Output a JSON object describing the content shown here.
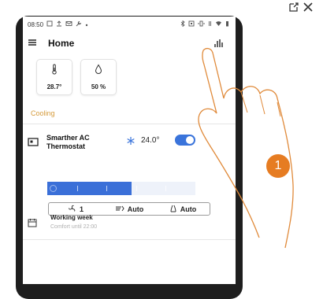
{
  "status_bar": {
    "time": "08:50"
  },
  "header": {
    "title": "Home"
  },
  "tiles": [
    {
      "icon": "thermometer-icon",
      "value": "28.7°"
    },
    {
      "icon": "humidity-drop-icon",
      "value": "50 %"
    }
  ],
  "section": {
    "label": "Cooling"
  },
  "device": {
    "name": "Smarther AC Thermostat",
    "mode_icon": "snowflake-icon",
    "setpoint": "24.0°",
    "power_on": true,
    "level_fraction": 0.57
  },
  "modes": {
    "fan_speed": "1",
    "swing": "Auto",
    "mode": "Auto"
  },
  "program": {
    "title": "Working week",
    "subtitle": "Comfort until 22:00"
  },
  "callout": {
    "number": "1"
  },
  "colors": {
    "accent": "#3a74db",
    "section_label": "#d59a3a",
    "badge": "#e67c22"
  }
}
